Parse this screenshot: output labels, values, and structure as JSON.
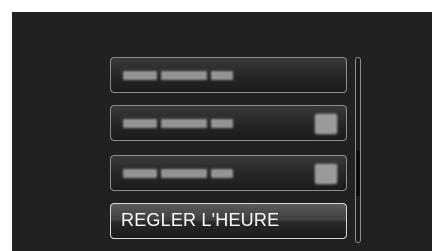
{
  "menu": {
    "items": [
      {
        "label": "",
        "obscured": true,
        "has_icon": false
      },
      {
        "label": "",
        "obscured": true,
        "has_icon": true
      },
      {
        "label": "",
        "obscured": true,
        "has_icon": true
      },
      {
        "label": "REGLER L'HEURE",
        "obscured": false,
        "selected": true
      }
    ]
  },
  "scrollbar": {
    "thumb_start_fraction": 0.5,
    "thumb_end_fraction": 0.75
  }
}
